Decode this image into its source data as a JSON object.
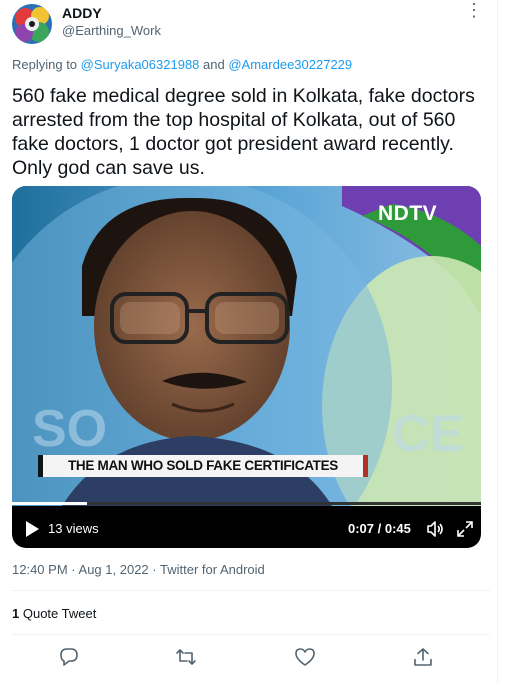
{
  "author": {
    "display_name": "ADDY",
    "handle": "@Earthing_Work",
    "avatar_icon": "avatar-icon",
    "more_label": "⋮"
  },
  "reply_context": {
    "prefix": "Replying to",
    "users": [
      "@Suryaka06321988",
      "@Amardee30227229"
    ],
    "joiner": "and"
  },
  "tweet_text": "560 fake medical degree sold in Kolkata, fake doctors arrested from the top hospital of Kolkata, out of 560 fake doctors, 1 doctor got president award recently. Only god can save us.",
  "video": {
    "channel_logo": "NDTV",
    "lower_third": "THE MAN WHO SOLD FAKE CERTIFICATES",
    "views": "13 views",
    "timestamp": "0:07 / 0:45",
    "progress_fraction": 0.16,
    "icons": [
      "play-icon",
      "volume-icon",
      "fullscreen-icon"
    ]
  },
  "meta": {
    "time": "12:40 PM",
    "date": "Aug 1, 2022",
    "source": "Twitter for Android",
    "separator": "·"
  },
  "quotes": {
    "count": "1",
    "label": "Quote Tweet"
  },
  "actions": [
    "reply-icon",
    "retweet-icon",
    "like-icon",
    "share-icon"
  ],
  "colors": {
    "link": "#1d9bf0",
    "secondary_text": "#536471",
    "primary_text": "#0f1419",
    "divider": "#eff3f4"
  }
}
